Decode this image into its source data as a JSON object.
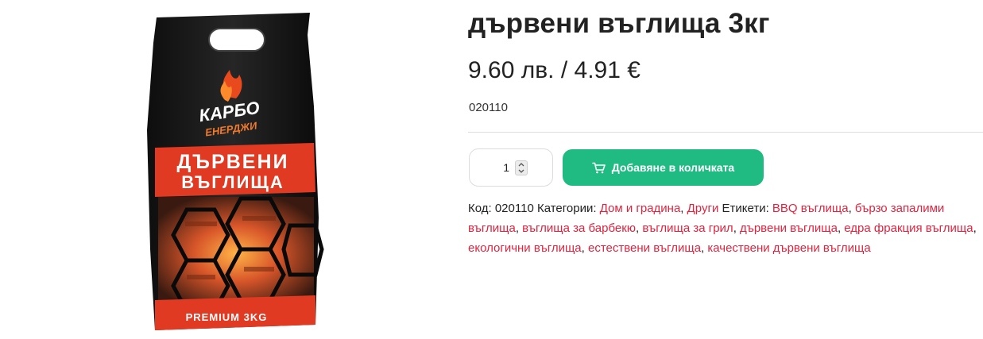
{
  "product": {
    "title": "дървени въглища 3кг",
    "price": "9.60 лв. / 4.91 €",
    "sku": "020110",
    "quantity": "1",
    "add_to_cart_label": "Добавяне в количката",
    "image": {
      "brand_line1": "КАРБО",
      "brand_line2": "ЕНЕРДЖИ",
      "headline_line1": "ДЪРВЕНИ",
      "headline_line2": "ВЪГЛИЩА",
      "footer": "PREMIUM 3KG"
    }
  },
  "meta": {
    "sku_label": "Код:",
    "sku_value": "020110",
    "categories_label": "Категории:",
    "categories": [
      "Дом и градина",
      "Други"
    ],
    "tags_label": "Етикети:",
    "tags": [
      "BBQ въглища",
      "бързо запалими въглища",
      "въглища за барбекю",
      "въглища за грил",
      "дървени въглища",
      "едра фракция въглища",
      "екологични въглища",
      "естествени въглища",
      "качествени дървени въглища"
    ]
  },
  "colors": {
    "accent_button": "#1fbb82",
    "link": "#e0233e"
  },
  "icons": {
    "cart": "cart-icon",
    "spinner_up": "chevron-up-icon",
    "spinner_down": "chevron-down-icon"
  }
}
